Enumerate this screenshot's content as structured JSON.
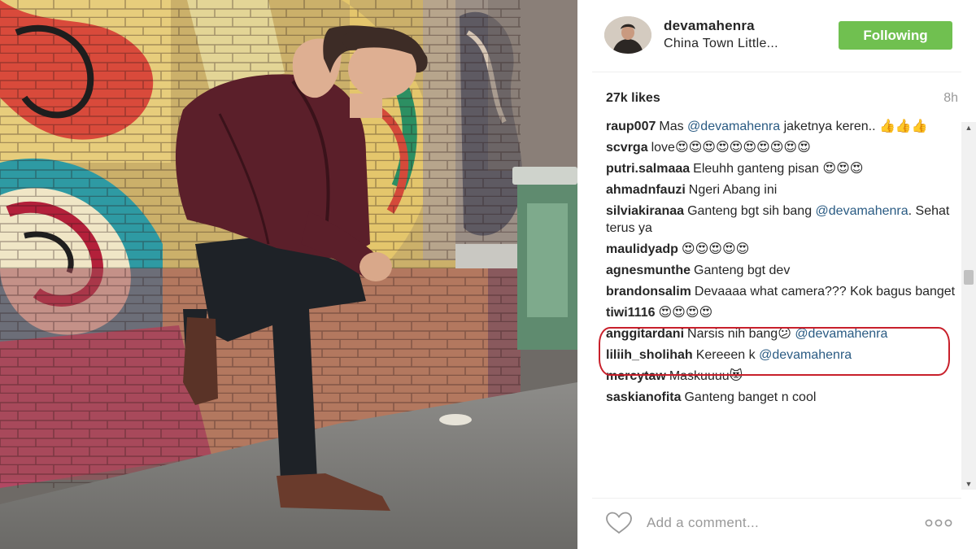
{
  "post": {
    "username": "devamahenra",
    "location": "China Town Little...",
    "follow_label": "Following",
    "likes": "27k likes",
    "time_ago": "8h"
  },
  "comments": [
    {
      "user": "raup007",
      "parts": [
        "Mas ",
        "@devamahenra",
        " jaketnya keren.. 👍👍👍"
      ]
    },
    {
      "user": "scvrga",
      "parts": [
        "love😍😍😍😍😍😍😍😍😍😍"
      ]
    },
    {
      "user": "putri.salmaaa",
      "parts": [
        "Eleuhh ganteng pisan 😍😍😍"
      ]
    },
    {
      "user": "ahmadnfauzi",
      "parts": [
        "Ngeri Abang ini"
      ]
    },
    {
      "user": "silviakiranaa",
      "parts": [
        "Ganteng bgt sih bang ",
        "@devamahenra",
        ". Sehat terus ya"
      ]
    },
    {
      "user": "maulidyadp",
      "parts": [
        "😍😍😍😍😍"
      ]
    },
    {
      "user": "agnesmunthe",
      "parts": [
        "Ganteng bgt dev"
      ]
    },
    {
      "user": "brandonsalim",
      "parts": [
        "Devaaaa what camera??? Kok bagus banget"
      ]
    },
    {
      "user": "tiwi1116",
      "parts": [
        "😍😍😍😍"
      ]
    },
    {
      "user": "anggitardani",
      "parts": [
        "Narsis nih bang😕 ",
        "@devamahenra"
      ]
    },
    {
      "user": "liliih_sholihah",
      "parts": [
        "Kereeen k ",
        "@devamahenra"
      ]
    },
    {
      "user": "mercytaw",
      "parts": [
        "Maskuuuu😻"
      ]
    },
    {
      "user": "saskianofita",
      "parts": [
        "Ganteng banget n cool"
      ]
    }
  ],
  "footer": {
    "add_comment_placeholder": "Add a comment...",
    "heart_icon": "heart-icon",
    "more_icon": "more-options-icon"
  },
  "colors": {
    "follow_button": "#70c050",
    "mention": "#2a5b83",
    "highlight": "#c8202b"
  }
}
